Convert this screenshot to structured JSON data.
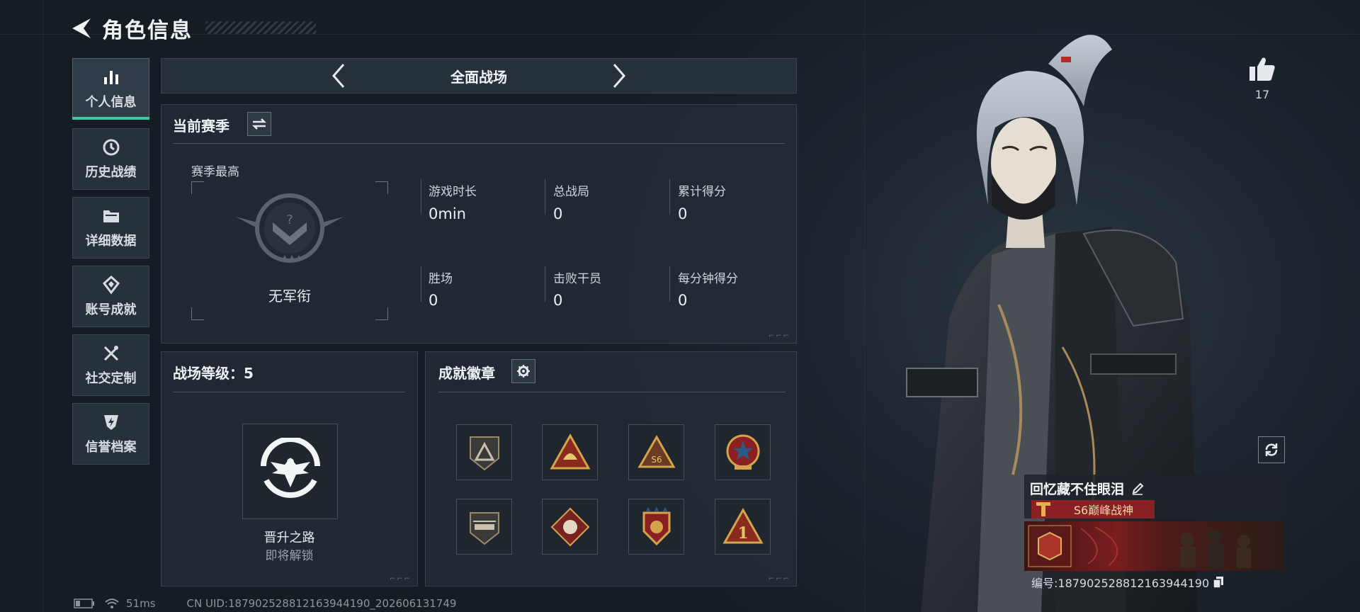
{
  "header": {
    "title": "角色信息"
  },
  "sidebar": {
    "items": [
      {
        "label": "个人信息",
        "icon": "bar-chart-icon",
        "active": true
      },
      {
        "label": "历史战绩",
        "icon": "history-icon"
      },
      {
        "label": "详细数据",
        "icon": "folder-icon"
      },
      {
        "label": "账号成就",
        "icon": "achievement-icon"
      },
      {
        "label": "社交定制",
        "icon": "tools-icon"
      },
      {
        "label": "信誉档案",
        "icon": "shield-icon"
      }
    ]
  },
  "mode_tab": {
    "label": "全面战场"
  },
  "season": {
    "title": "当前赛季",
    "best_label": "赛季最高",
    "rank_name": "无军衔",
    "stats": [
      {
        "label": "游戏时长",
        "value": "0min"
      },
      {
        "label": "总战局",
        "value": "0"
      },
      {
        "label": "累计得分",
        "value": "0"
      },
      {
        "label": "胜场",
        "value": "0"
      },
      {
        "label": "击败干员",
        "value": "0"
      },
      {
        "label": "每分钟得分",
        "value": "0"
      }
    ]
  },
  "level_panel": {
    "title": "战场等级：5",
    "reward_name": "晋升之路",
    "reward_status": "即将解锁"
  },
  "badges_panel": {
    "title": "成就徽章",
    "badges": [
      "badge-1",
      "badge-2",
      "badge-3",
      "badge-4",
      "badge-5",
      "badge-6",
      "badge-7",
      "badge-8"
    ]
  },
  "likes": {
    "count": "17"
  },
  "card": {
    "name": "回忆藏不住眼泪",
    "title": "S6巅峰战神",
    "id": "编号:187902528812163944190"
  },
  "footer": {
    "ping": "51ms",
    "uid": "CN UID:187902528812163944190_202606131749"
  },
  "colors": {
    "accent": "#3fc99a",
    "card_red": "#8a1f24"
  }
}
